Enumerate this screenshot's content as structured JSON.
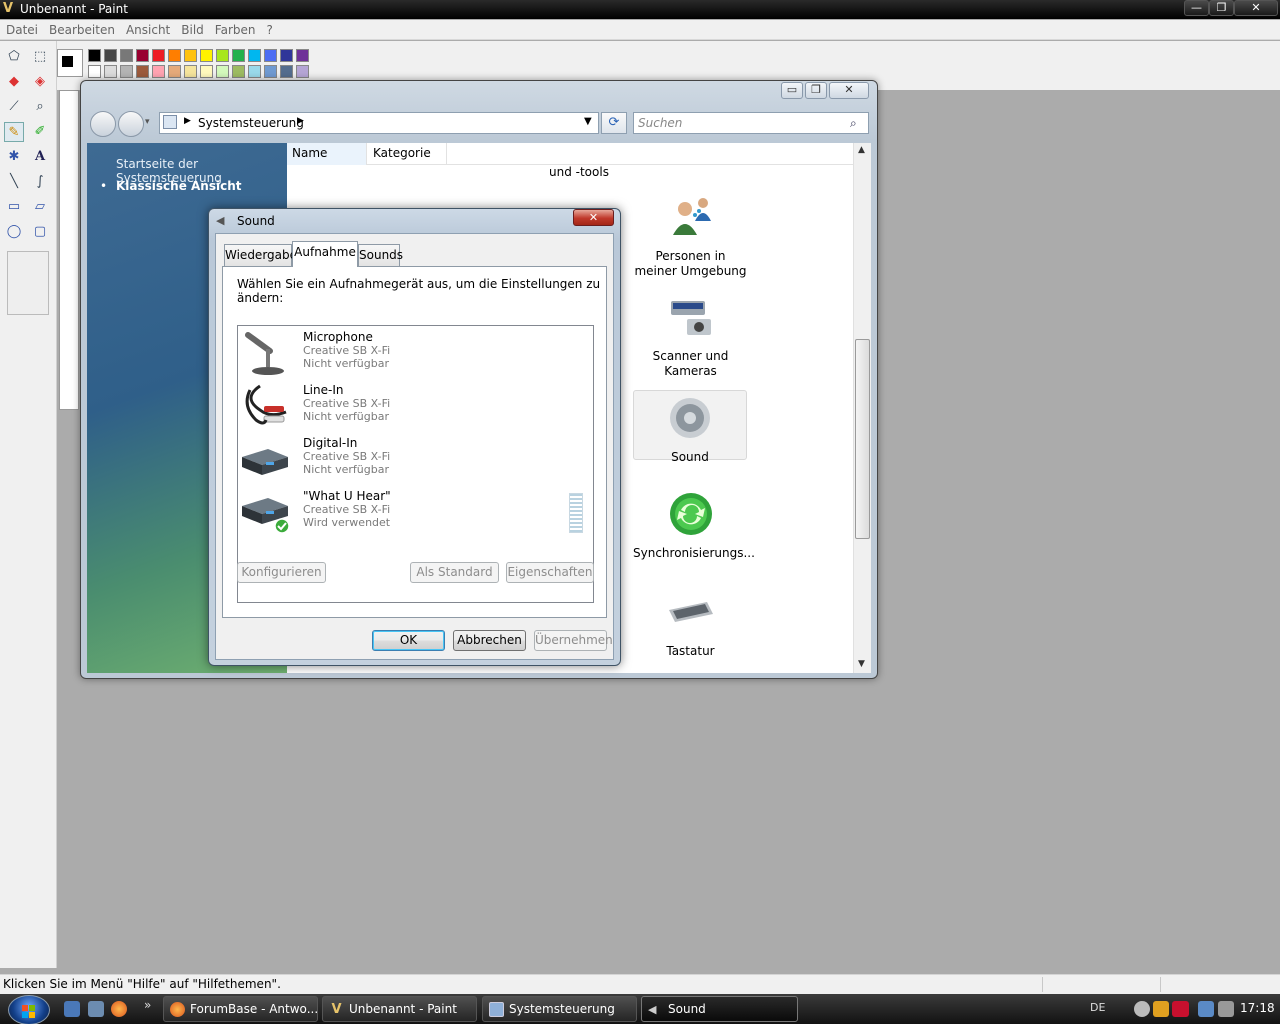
{
  "paint": {
    "title": "Unbenannt - Paint",
    "menu": [
      "Datei",
      "Bearbeiten",
      "Ansicht",
      "Bild",
      "Farben",
      "?"
    ],
    "status": "Klicken Sie im Menü \"Hilfe\" auf \"Hilfethemen\".",
    "palette_top": [
      "#000000",
      "#464646",
      "#787878",
      "#990030",
      "#ed1c24",
      "#ff7e00",
      "#ffc20e",
      "#fff200",
      "#a8e61d",
      "#22b14c",
      "#00b7ef",
      "#4d6df3",
      "#2f3699",
      "#6f3198"
    ],
    "palette_bottom": [
      "#ffffff",
      "#dcdcdc",
      "#b4b4b4",
      "#9c5a3c",
      "#ffa3b1",
      "#e5aa7a",
      "#f5e49c",
      "#fff9bd",
      "#d3f9bc",
      "#9dbb61",
      "#99d9ea",
      "#709ad1",
      "#546d8e",
      "#b5a5d5"
    ]
  },
  "control_panel": {
    "address": "Systemsteuerung",
    "search_placeholder": "Suchen",
    "left_links": [
      "Startseite der Systemsteuerung",
      "Klassische Ansicht"
    ],
    "columns": [
      "Name",
      "Kategorie"
    ],
    "top_text": "und -tools",
    "items": [
      {
        "label": "Personen in meiner Umgebung",
        "icon": "people-icon"
      },
      {
        "label": "Scanner und Kameras",
        "icon": "scanner-icon"
      },
      {
        "label": "Sound",
        "icon": "speaker-icon"
      },
      {
        "label": "Synchronisierungs...",
        "icon": "sync-icon"
      },
      {
        "label": "Tastatur",
        "icon": "keyboard-icon"
      }
    ]
  },
  "sound_dialog": {
    "title": "Sound",
    "tabs": [
      "Wiedergabe",
      "Aufnahme",
      "Sounds"
    ],
    "selected_tab": "Aufnahme",
    "instruction": "Wählen Sie ein Aufnahmegerät aus, um die Einstellungen zu ändern:",
    "devices": [
      {
        "name": "Microphone",
        "driver": "Creative SB X-Fi",
        "status": "Nicht verfügbar",
        "icon": "microphone-icon"
      },
      {
        "name": "Line-In",
        "driver": "Creative SB X-Fi",
        "status": "Nicht verfügbar",
        "icon": "line-in-cable-icon"
      },
      {
        "name": "Digital-In",
        "driver": "Creative SB X-Fi",
        "status": "Nicht verfügbar",
        "icon": "audio-device-icon"
      },
      {
        "name": "\"What U Hear\"",
        "driver": "Creative SB X-Fi",
        "status": "Wird verwendet",
        "icon": "audio-device-default-icon"
      }
    ],
    "buttons": {
      "configure": "Konfigurieren",
      "set_default": "Als Standard",
      "properties": "Eigenschaften",
      "ok": "OK",
      "cancel": "Abbrechen",
      "apply": "Übernehmen"
    }
  },
  "taskbar": {
    "chevron": "»",
    "buttons": [
      "ForumBase - Antwo...",
      "Unbenannt - Paint",
      "Systemsteuerung",
      "Sound"
    ],
    "active": "Sound",
    "language": "DE",
    "clock": "17:18"
  }
}
